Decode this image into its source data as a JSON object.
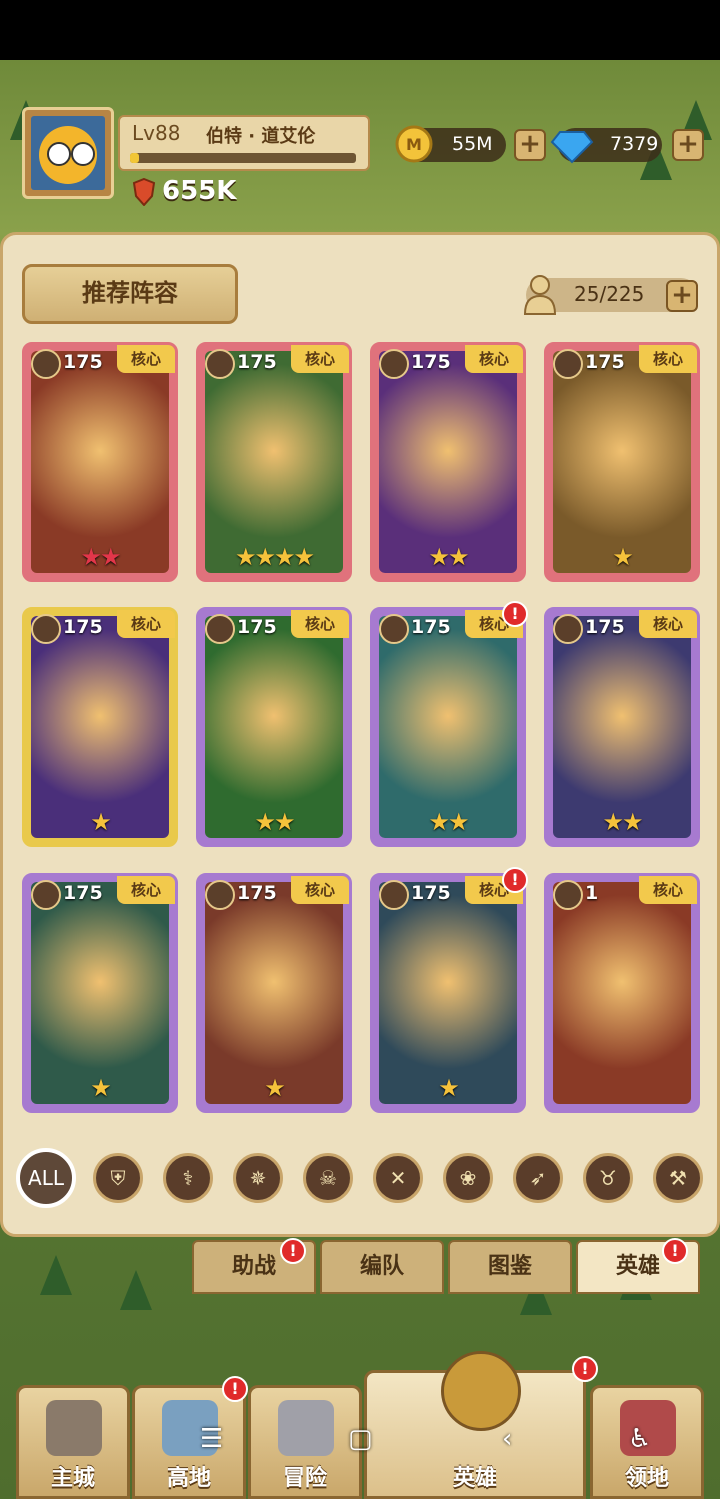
{
  "player": {
    "level": "Lv88",
    "name": "伯特 · 道艾伦",
    "power": "655K",
    "xp_fraction": 0.04
  },
  "currency": {
    "gold": "55M",
    "gems": "7379"
  },
  "panel": {
    "recommend_label": "推荐阵容",
    "hero_count": "25/225"
  },
  "core_label": "核心",
  "heroes": [
    {
      "level": "175",
      "stars": "★★",
      "star_color": "red",
      "frame": "#e0727c",
      "bg": "#8a3a26"
    },
    {
      "level": "175",
      "stars": "★★★★",
      "star_color": "gold",
      "frame": "#e0727c",
      "bg": "#3f6b33"
    },
    {
      "level": "175",
      "stars": "★★",
      "star_color": "gold",
      "frame": "#e0727c",
      "bg": "#5a2f7a"
    },
    {
      "level": "175",
      "stars": "★",
      "star_color": "gold",
      "frame": "#e0727c",
      "bg": "#7a5a2a"
    },
    {
      "level": "175",
      "stars": "★",
      "star_color": "gold",
      "frame": "#e9c94b",
      "bg": "#4a2f7a"
    },
    {
      "level": "175",
      "stars": "★★",
      "star_color": "gold",
      "frame": "#a77ad0",
      "bg": "#2f6b2f"
    },
    {
      "level": "175",
      "stars": "★★",
      "star_color": "gold",
      "frame": "#a77ad0",
      "bg": "#2f6b6b"
    },
    {
      "level": "175",
      "stars": "★★",
      "star_color": "gold",
      "frame": "#a77ad0",
      "bg": "#3d3a70"
    },
    {
      "level": "175",
      "stars": "★",
      "star_color": "gold",
      "frame": "#a77ad0",
      "bg": "#2f5a4a"
    },
    {
      "level": "175",
      "stars": "★",
      "star_color": "gold",
      "frame": "#a77ad0",
      "bg": "#7a3a2a"
    },
    {
      "level": "175",
      "stars": "★",
      "star_color": "gold",
      "frame": "#a77ad0",
      "bg": "#2f4a5a"
    },
    {
      "level": "1",
      "stars": "",
      "star_color": "gold",
      "frame": "#a77ad0",
      "bg": "#8a3a26"
    }
  ],
  "filters": {
    "all": "ALL"
  },
  "tabs": [
    "助战",
    "编队",
    "图鉴",
    "英雄"
  ],
  "nav": [
    "主城",
    "高地",
    "冒险",
    "英雄",
    "领地"
  ],
  "alert_mark": "!"
}
